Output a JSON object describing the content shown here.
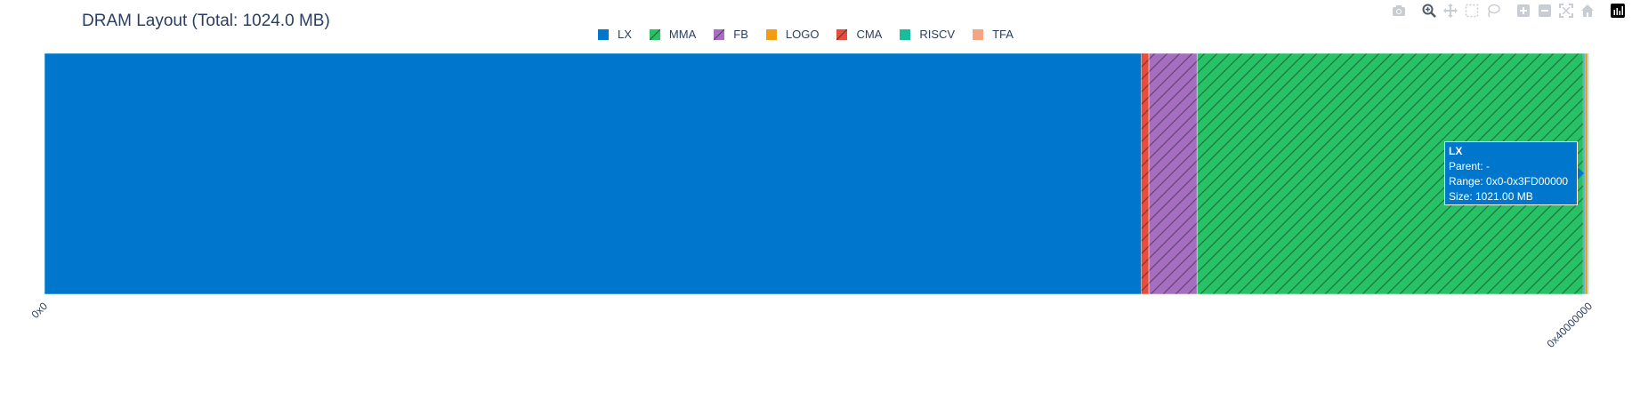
{
  "chart_data": {
    "type": "bar",
    "orientation": "horizontal-stacked",
    "title": "DRAM Layout (Total: 1024.0 MB)",
    "xlim": [
      0,
      1024
    ],
    "x_unit": "MB",
    "x_tick_labels": [
      "0x0",
      "0x40000000"
    ],
    "legend_placement": "top",
    "series": [
      {
        "name": "LX",
        "start": 0,
        "size": 1021.0,
        "color": "#0077cc",
        "pattern": "solid"
      },
      {
        "name": "MMA",
        "start": 764,
        "size": 256,
        "color": "#27c266",
        "pattern": "hatch"
      },
      {
        "name": "FB",
        "start": 732,
        "size": 32,
        "color": "#a66ec0",
        "pattern": "hatch"
      },
      {
        "name": "LOGO",
        "start": 1021,
        "size": 2,
        "color": "#f39c12",
        "pattern": "solid"
      },
      {
        "name": "CMA",
        "start": 727,
        "size": 5,
        "color": "#e74c3c",
        "pattern": "hatch"
      },
      {
        "name": "RISCV",
        "start": 1023,
        "size": 0.5,
        "color": "#1abc9c",
        "pattern": "solid"
      },
      {
        "name": "TFA",
        "start": 1023.5,
        "size": 0.5,
        "color": "#f4a582",
        "pattern": "solid"
      }
    ],
    "hover": {
      "title": "LX",
      "parent": "Parent: -",
      "range": "Range: 0x0-0x3FD00000",
      "size": "Size: 1021.00 MB"
    }
  },
  "toolbar": {
    "icons": [
      "camera-icon",
      "zoom-icon",
      "pan-icon",
      "box-select-icon",
      "lasso-icon",
      "zoom-in-icon",
      "zoom-out-icon",
      "autoscale-icon",
      "reset-axes-icon",
      "plotly-logo-icon"
    ]
  }
}
